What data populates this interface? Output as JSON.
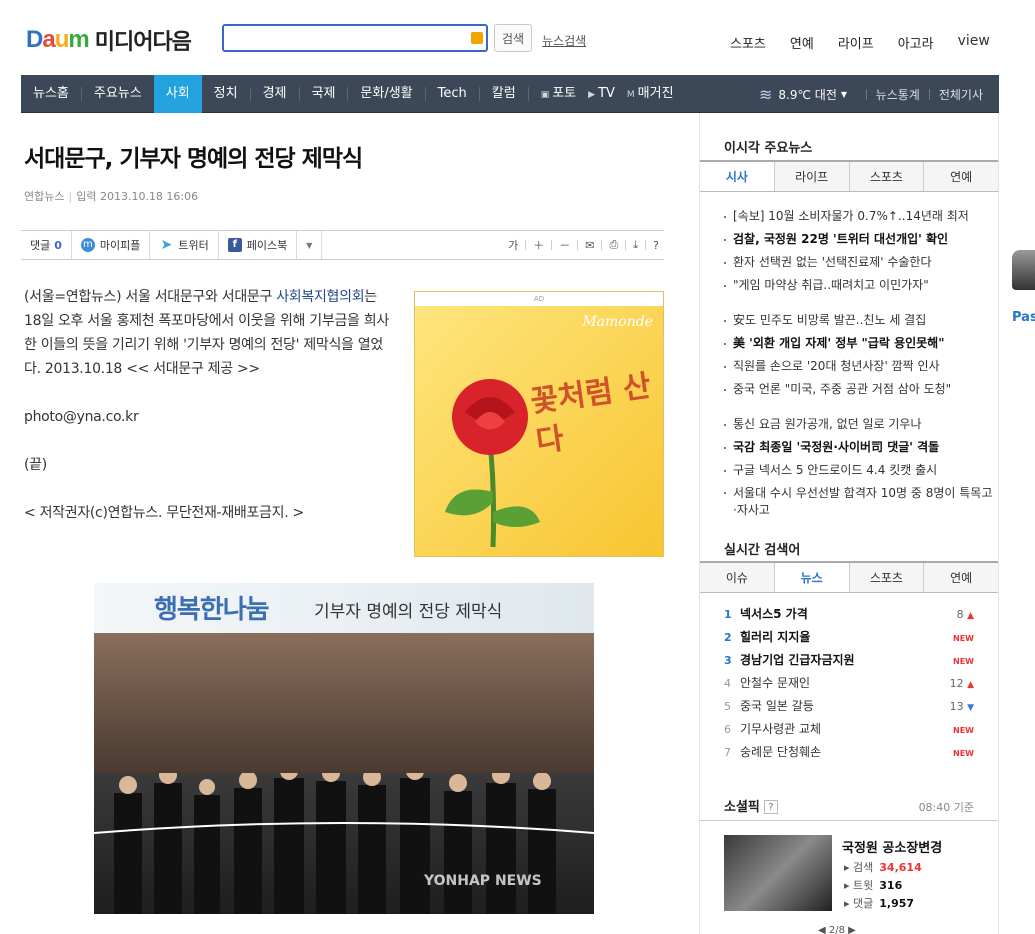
{
  "header": {
    "logo": "Daum",
    "media": "미디어다음",
    "search_placeholder": "",
    "search_button": "검색",
    "news_search": "뉴스검색",
    "top_links": [
      "스포츠",
      "연예",
      "라이프",
      "아고라",
      "view"
    ]
  },
  "gnb": {
    "items": [
      "뉴스홈",
      "주요뉴스",
      "사회",
      "정치",
      "경제",
      "국제",
      "문화/생활",
      "Tech",
      "칼럼"
    ],
    "active": "사회",
    "media_items": [
      "포토",
      "TV",
      "매거진"
    ],
    "weather": "8.9℃ 대전",
    "right_links": [
      "뉴스통계",
      "전체기사"
    ]
  },
  "article": {
    "title": "서대문구, 기부자 명예의 전당 제막식",
    "source": "연합뉴스",
    "input_label": "입력",
    "date": "2013.10.18 16:06",
    "toolbar": {
      "comment_label": "댓글",
      "comment_count": "0",
      "mypeople": "마이피플",
      "twitter": "트위터",
      "facebook": "페이스북"
    },
    "body": {
      "p1_prefix": "(서울=연합뉴스) 서울 서대문구와 서대문구 ",
      "p1_link": "사회복지협의회",
      "p1_suffix": "는 18일 오후 서울 홍제천 폭포마당에서 이웃을 위해 기부금을 희사한 이들의 뜻을 기리기 위해 '기부자 명예의 전당' 제막식을 열었다. 2013.10.18 << 서대문구 제공 >>",
      "p2": "photo@yna.co.kr",
      "p3": "(끝)",
      "p4": "< 저작권자(c)연합뉴스. 무단전재-재배포금지. >"
    },
    "ad": {
      "label": "AD",
      "brand": "Mamonde",
      "slogan": "꽃처럼 산다"
    },
    "photo": {
      "banner_main": "행복한나눔",
      "banner_sub": "기부자 명예의 전당 제막식",
      "watermark": "YONHAP NEWS"
    }
  },
  "sidebar": {
    "top_news_title": "이시각 주요뉴스",
    "top_tabs": [
      "시사",
      "라이프",
      "스포츠",
      "연예"
    ],
    "top_active": "시사",
    "news_groups": [
      [
        {
          "text": "[속보] 10월 소비자물가 0.7%↑..14년래 최저",
          "bold": false
        },
        {
          "text": "검찰, 국정원 22명 '트위터 대선개입' 확인",
          "bold": true
        },
        {
          "text": "환자 선택권 없는 '선택진료제' 수술한다",
          "bold": false
        },
        {
          "text": "\"게임 마약상 취급..때려치고 이민가자\"",
          "bold": false
        }
      ],
      [
        {
          "text": "安도 민주도 비망록 발끈..친노 세 결집",
          "bold": false
        },
        {
          "text": "美 '외환 개입 자제' 정부 \"급락 용인못해\"",
          "bold": true
        },
        {
          "text": "직원를 손으로 '20대 청년사장' 깜짝 인사",
          "bold": false
        },
        {
          "text": "중국 언론 \"미국, 주중 공관 거점 삼아 도청\"",
          "bold": false
        }
      ],
      [
        {
          "text": "통신 요금 원가공개, 없던 일로 기우나",
          "bold": false
        },
        {
          "text": "국감 최종일 '국정원·사이버司 댓글' 격돌",
          "bold": true
        },
        {
          "text": "구글 넥서스 5 안드로이드 4.4 킷캣 출시",
          "bold": false
        },
        {
          "text": "서울대 수시 우선선발 합격자 10명 중 8명이 특목고·자사고",
          "bold": false
        }
      ]
    ],
    "realtime_title": "실시간 검색어",
    "rt_tabs": [
      "이슈",
      "뉴스",
      "스포츠",
      "연예"
    ],
    "rt_active": "뉴스",
    "ranks": [
      {
        "n": "1",
        "t": "넥서스5 가격",
        "b": true,
        "num": "8",
        "kind": "up"
      },
      {
        "n": "2",
        "t": "힐러리 지지율",
        "b": true,
        "num": "",
        "kind": "new"
      },
      {
        "n": "3",
        "t": "경남기업 긴급자금지원",
        "b": true,
        "num": "",
        "kind": "new"
      },
      {
        "n": "4",
        "t": "안철수 문재인",
        "b": false,
        "num": "12",
        "kind": "up"
      },
      {
        "n": "5",
        "t": "중국 일본 갈등",
        "b": false,
        "num": "13",
        "kind": "down"
      },
      {
        "n": "6",
        "t": "기무사령관 교체",
        "b": false,
        "num": "",
        "kind": "new"
      },
      {
        "n": "7",
        "t": "숭례문 단청훼손",
        "b": false,
        "num": "",
        "kind": "new"
      }
    ],
    "new_label": "NEW",
    "social_title": "소셜픽",
    "social_help": "?",
    "social_time": "08:40 기준",
    "social_item": {
      "title": "국정원 공소장변경",
      "search_label": "검색",
      "search_count": "34,614",
      "tweet_label": "트윗",
      "tweet_count": "316",
      "comment_label": "댓글",
      "comment_count": "1,957"
    },
    "pager": "2/8"
  },
  "side_ad": {
    "text": "Pas"
  }
}
